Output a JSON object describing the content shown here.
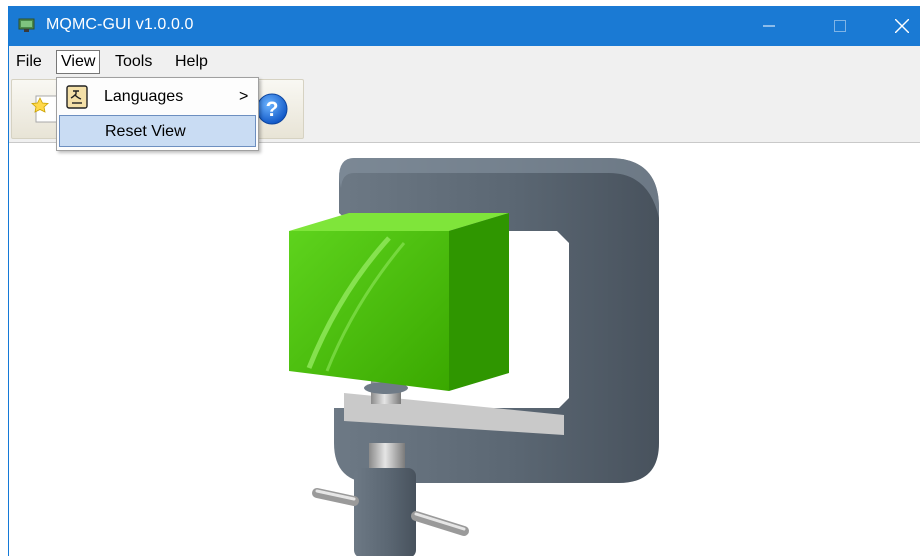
{
  "window": {
    "title": "MQMC-GUI v1.0.0.0",
    "controls": {
      "minimize": "—",
      "maximize": "☐",
      "close": "✕"
    }
  },
  "menubar": {
    "items": [
      {
        "label": "File"
      },
      {
        "label": "View"
      },
      {
        "label": "Tools"
      },
      {
        "label": "Help"
      }
    ]
  },
  "view_menu": {
    "items": [
      {
        "label": "Languages",
        "submenu_arrow": ">"
      },
      {
        "label": "Reset View"
      }
    ]
  },
  "toolbar": {
    "buttons": [
      {
        "icon": "new-star-icon"
      },
      {
        "icon": "help-icon",
        "glyph": "?"
      }
    ]
  },
  "colors": {
    "titlebar": "#1a7ad4",
    "menu_highlight": "#c9dcf3",
    "logo_green": "#44bb00",
    "logo_gray": "#5f6d7a"
  }
}
